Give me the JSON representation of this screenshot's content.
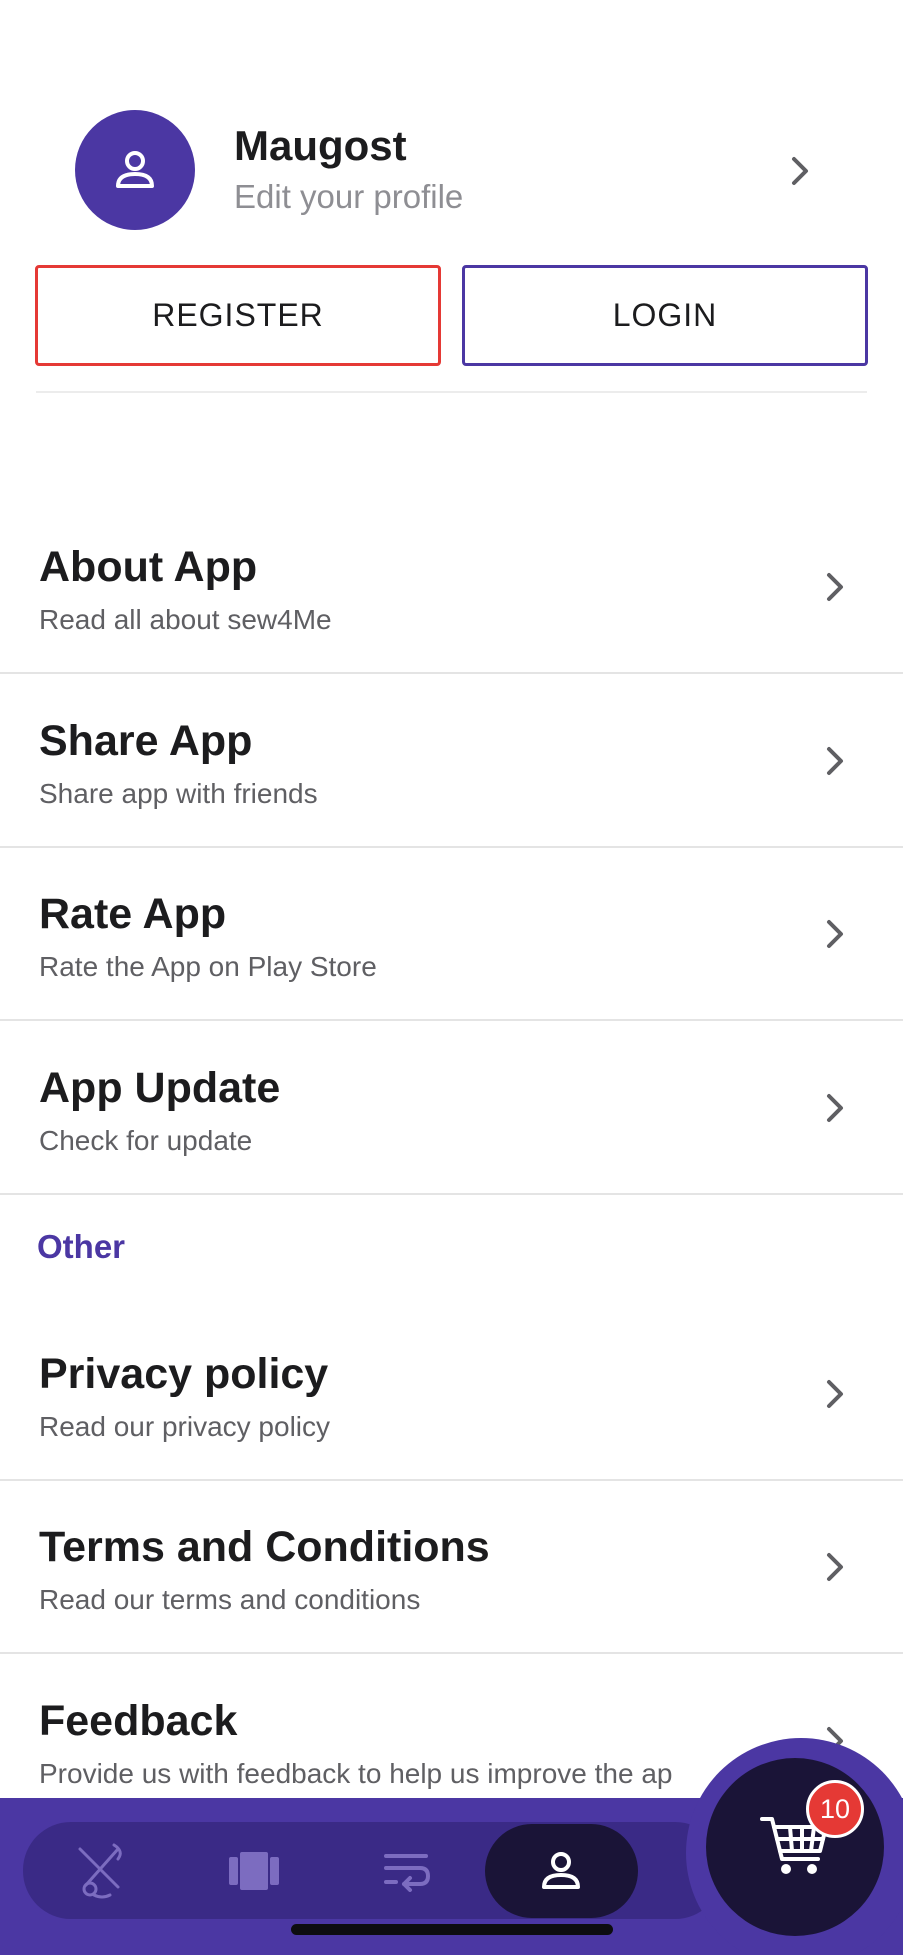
{
  "profile": {
    "name": "Maugost",
    "subtitle": "Edit your profile"
  },
  "auth": {
    "register_label": "REGISTER",
    "login_label": "LOGIN"
  },
  "menu": [
    {
      "title": "About App",
      "subtitle": "Read all about sew4Me"
    },
    {
      "title": "Share App",
      "subtitle": "Share app with friends"
    },
    {
      "title": "Rate App",
      "subtitle": "Rate the App on Play Store"
    },
    {
      "title": "App Update",
      "subtitle": "Check for update"
    }
  ],
  "other": {
    "section_label": "Other",
    "items": [
      {
        "title": "Privacy policy",
        "subtitle": "Read our privacy policy"
      },
      {
        "title": "Terms and Conditions",
        "subtitle": "Read our terms and conditions"
      },
      {
        "title": "Feedback",
        "subtitle": "Provide us with feedback to help us improve the ap"
      }
    ]
  },
  "bottom_nav": {
    "items": [
      "tailoring-icon",
      "fabric-icon",
      "orders-icon",
      "profile-icon"
    ],
    "active": "profile-icon"
  },
  "cart": {
    "badge_count": "10"
  },
  "colors": {
    "primary": "#4b37a3",
    "dark": "#1a1437",
    "danger": "#e53935"
  }
}
